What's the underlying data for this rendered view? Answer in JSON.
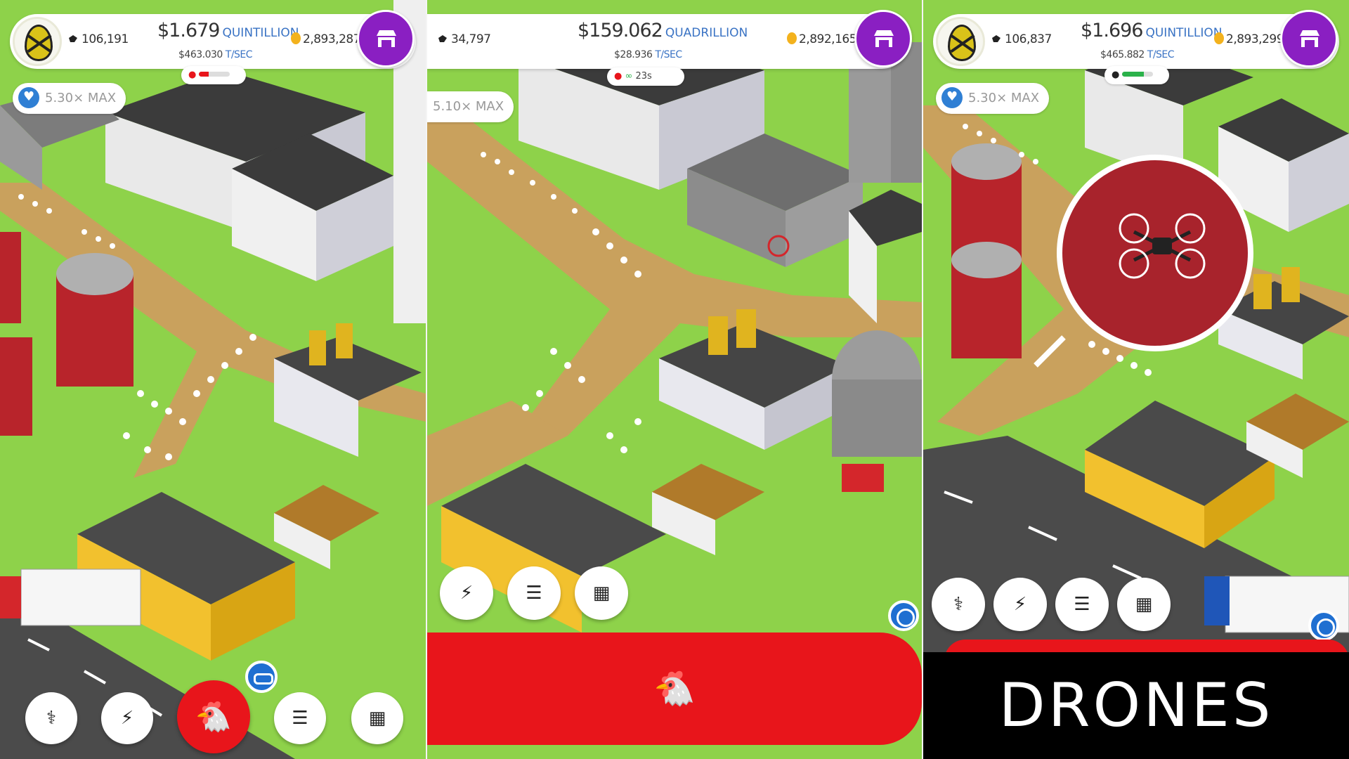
{
  "panels": [
    {
      "chickens": "106,191",
      "money_amount": "$1.679",
      "money_unit": "QUINTILLION",
      "rate_amount": "$463.030",
      "rate_unit": "T/SEC",
      "golden_eggs": "2,893,287",
      "boost": "5.30× MAX"
    },
    {
      "chickens": "34,797",
      "money_amount": "$159.062",
      "money_unit": "QUADRILLION",
      "rate_amount": "$28.936",
      "rate_unit": "T/SEC",
      "golden_eggs": "2,892,165",
      "status": "23s",
      "boost": "5.10× MAX"
    },
    {
      "chickens": "106,837",
      "money_amount": "$1.696",
      "money_unit": "QUINTILLION",
      "rate_amount": "$465.882",
      "rate_unit": "T/SEC",
      "golden_eggs": "2,893,299",
      "boost": "5.30× MAX"
    }
  ],
  "caption": "DRONES",
  "icons": {
    "research": "flask-icon",
    "boost": "lightning-icon",
    "hatch": "chicken-icon",
    "missions": "checklist-icon",
    "menu": "grid-icon",
    "shop": "shop-icon",
    "chickens": "chicken-icon",
    "golden_egg": "golden-egg-icon"
  },
  "colors": {
    "grass": "#8ed24a",
    "hatch_red": "#e8151b",
    "shop_purple": "#8a1fc2",
    "accent_blue": "#3a73c4",
    "golden": "#f3b21d"
  }
}
